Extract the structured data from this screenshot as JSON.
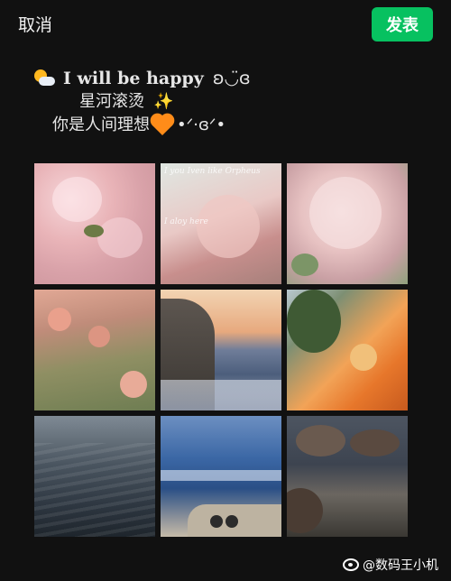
{
  "topbar": {
    "cancel_label": "取消",
    "publish_label": "发表",
    "publish_color": "#07c160"
  },
  "caption": {
    "line1_text": "I will be happy",
    "line1_kaomoji": "ʚ◡̈ɞ",
    "line2_text": "星河滚烫",
    "line2_emoji": "✨",
    "line3_text": "你是人间理想",
    "line3_kaomoji": "•ᐟ·ɞᐟ•",
    "icons": [
      "sun-behind-cloud-icon",
      "sparkles-icon",
      "orange-heart-icon"
    ]
  },
  "photos": {
    "photo2_overlay_line1": "I you Iven like Orpheus",
    "photo2_overlay_line2": "I aloy here"
  },
  "watermark": {
    "text": "@数码王小机",
    "icon": "weibo-icon"
  }
}
